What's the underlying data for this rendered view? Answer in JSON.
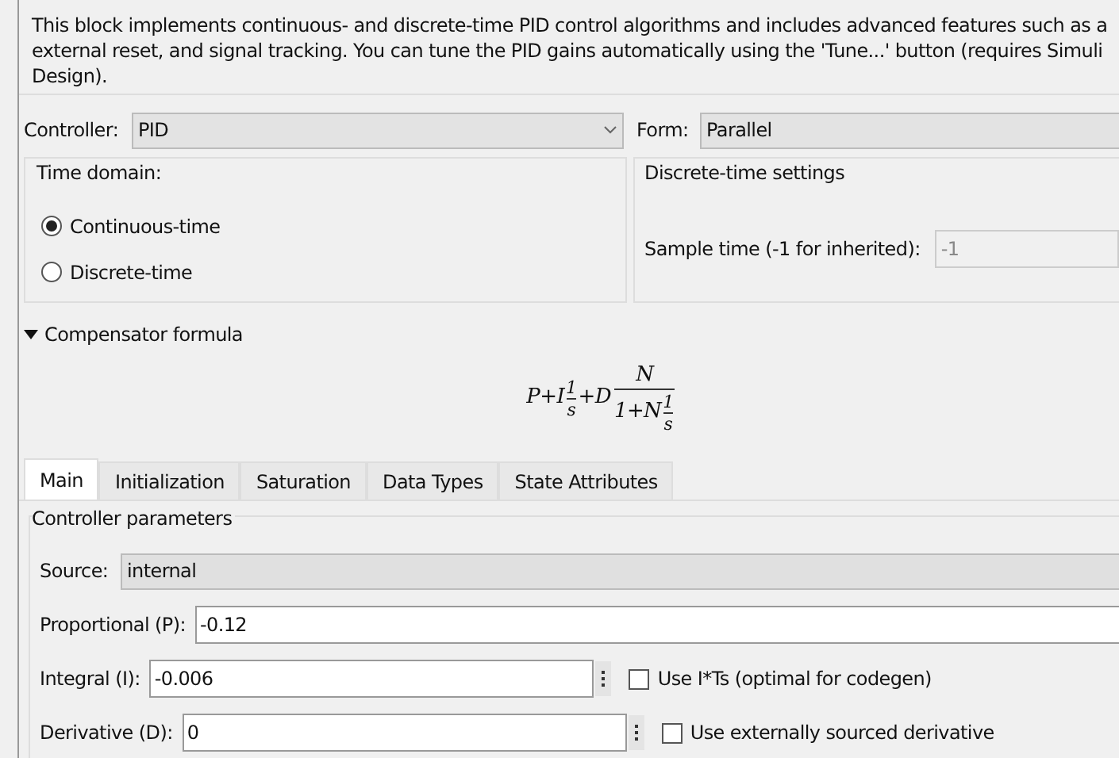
{
  "description": [
    "This block implements continuous- and discrete-time PID control algorithms and includes advanced features such as a",
    "external reset, and signal tracking. You can tune the PID gains automatically using the 'Tune...' button (requires Simuli",
    "Design)."
  ],
  "controller": {
    "label": "Controller:",
    "value": "PID"
  },
  "form": {
    "label": "Form:",
    "value": "Parallel"
  },
  "time_domain": {
    "title": "Time domain:",
    "options": [
      {
        "label": "Continuous-time",
        "selected": true
      },
      {
        "label": "Discrete-time",
        "selected": false
      }
    ]
  },
  "discrete_settings": {
    "title": "Discrete-time settings",
    "sample_time": {
      "label": "Sample time (-1 for inherited):",
      "value": "-1",
      "disabled": true
    }
  },
  "compensator": {
    "label": "Compensator formula",
    "expanded": true,
    "formula": {
      "lead": "P+I",
      "f1_num": "1",
      "f1_den": "s",
      "mid": "+D",
      "f2_num": "N",
      "f2_den": "1+N",
      "f3_num": "1",
      "f3_den": "s"
    }
  },
  "tabs": [
    {
      "label": "Main",
      "selected": true
    },
    {
      "label": "Initialization",
      "selected": false
    },
    {
      "label": "Saturation",
      "selected": false
    },
    {
      "label": "Data Types",
      "selected": false
    },
    {
      "label": "State Attributes",
      "selected": false
    }
  ],
  "params": {
    "title": "Controller parameters",
    "source": {
      "label": "Source:",
      "value": "internal"
    },
    "rows": [
      {
        "kind": "wide",
        "label": "Proportional (P):",
        "value": "-0.12"
      },
      {
        "kind": "check",
        "label": "Integral (I):",
        "value": "-0.006",
        "option": "Use I*Ts (optimal for codegen)",
        "checked": false
      },
      {
        "kind": "check",
        "label": "Derivative (D):",
        "value": "0",
        "option": "Use externally sourced derivative",
        "checked": false
      }
    ]
  }
}
